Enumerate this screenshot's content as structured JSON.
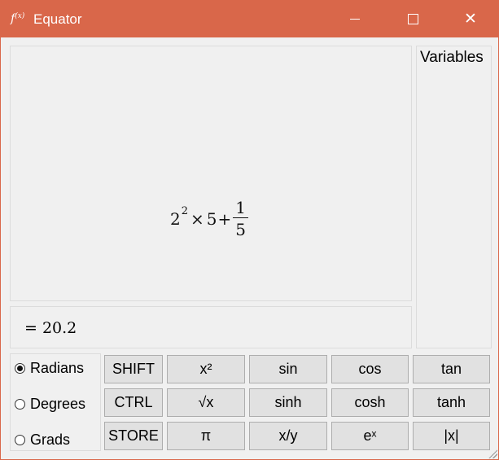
{
  "titlebar": {
    "icon_text": "f",
    "icon_sub": "(x)",
    "title": "Equator",
    "close_glyph": "✕"
  },
  "editor": {
    "base": "2",
    "exponent": "2",
    "times": "×",
    "mult": "5",
    "plus": "+",
    "frac_num": "1",
    "frac_den": "5"
  },
  "variables": {
    "label": "Variables"
  },
  "result": {
    "text": "= 20.2"
  },
  "angle_mode": {
    "options": [
      {
        "label": "Radians",
        "selected": true
      },
      {
        "label": "Degrees",
        "selected": false
      },
      {
        "label": "Grads",
        "selected": false
      }
    ]
  },
  "keypad": {
    "row1": [
      "SHIFT",
      "x²",
      "sin",
      "cos",
      "tan"
    ],
    "row2": [
      "CTRL",
      "√x",
      "sinh",
      "cosh",
      "tanh"
    ],
    "row3": [
      "STORE",
      "π",
      "x/y",
      "eˣ",
      "|x|"
    ]
  },
  "colors": {
    "titlebar": "#d9674a",
    "window_bg": "#f0f0f0",
    "button_bg": "#e1e1e1"
  }
}
